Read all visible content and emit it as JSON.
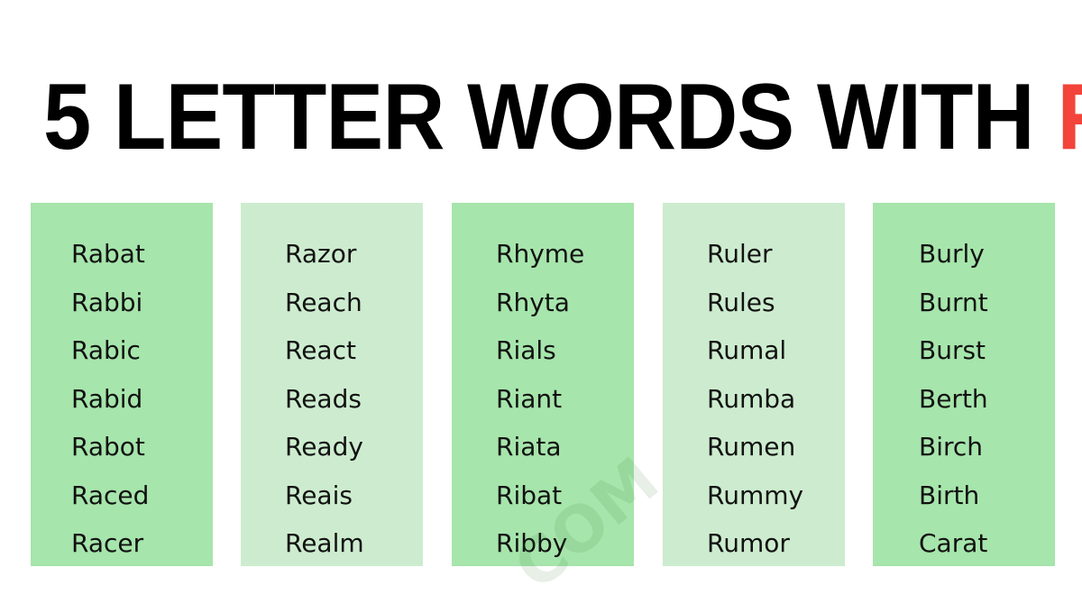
{
  "title": {
    "main": "5 LETTER WORDS WITH ",
    "accent_letter": "R",
    "accent_color": "#f2443a"
  },
  "colors": {
    "column_dark": "#a6e5ab",
    "column_light": "#cdeccf"
  },
  "watermark": "COM",
  "columns": [
    {
      "words": [
        "Rabat",
        "Rabbi",
        "Rabic",
        "Rabid",
        "Rabot",
        "Raced",
        "Racer"
      ]
    },
    {
      "words": [
        "Razor",
        "Reach",
        "React",
        "Reads",
        "Ready",
        "Reais",
        "Realm"
      ]
    },
    {
      "words": [
        "Rhyme",
        "Rhyta",
        "Rials",
        "Riant",
        "Riata",
        "Ribat",
        "Ribby"
      ]
    },
    {
      "words": [
        "Ruler",
        "Rules",
        "Rumal",
        "Rumba",
        "Rumen",
        "Rummy",
        "Rumor"
      ]
    },
    {
      "words": [
        "Burly",
        "Burnt",
        "Burst",
        "Berth",
        "Birch",
        "Birth",
        "Carat"
      ]
    }
  ]
}
